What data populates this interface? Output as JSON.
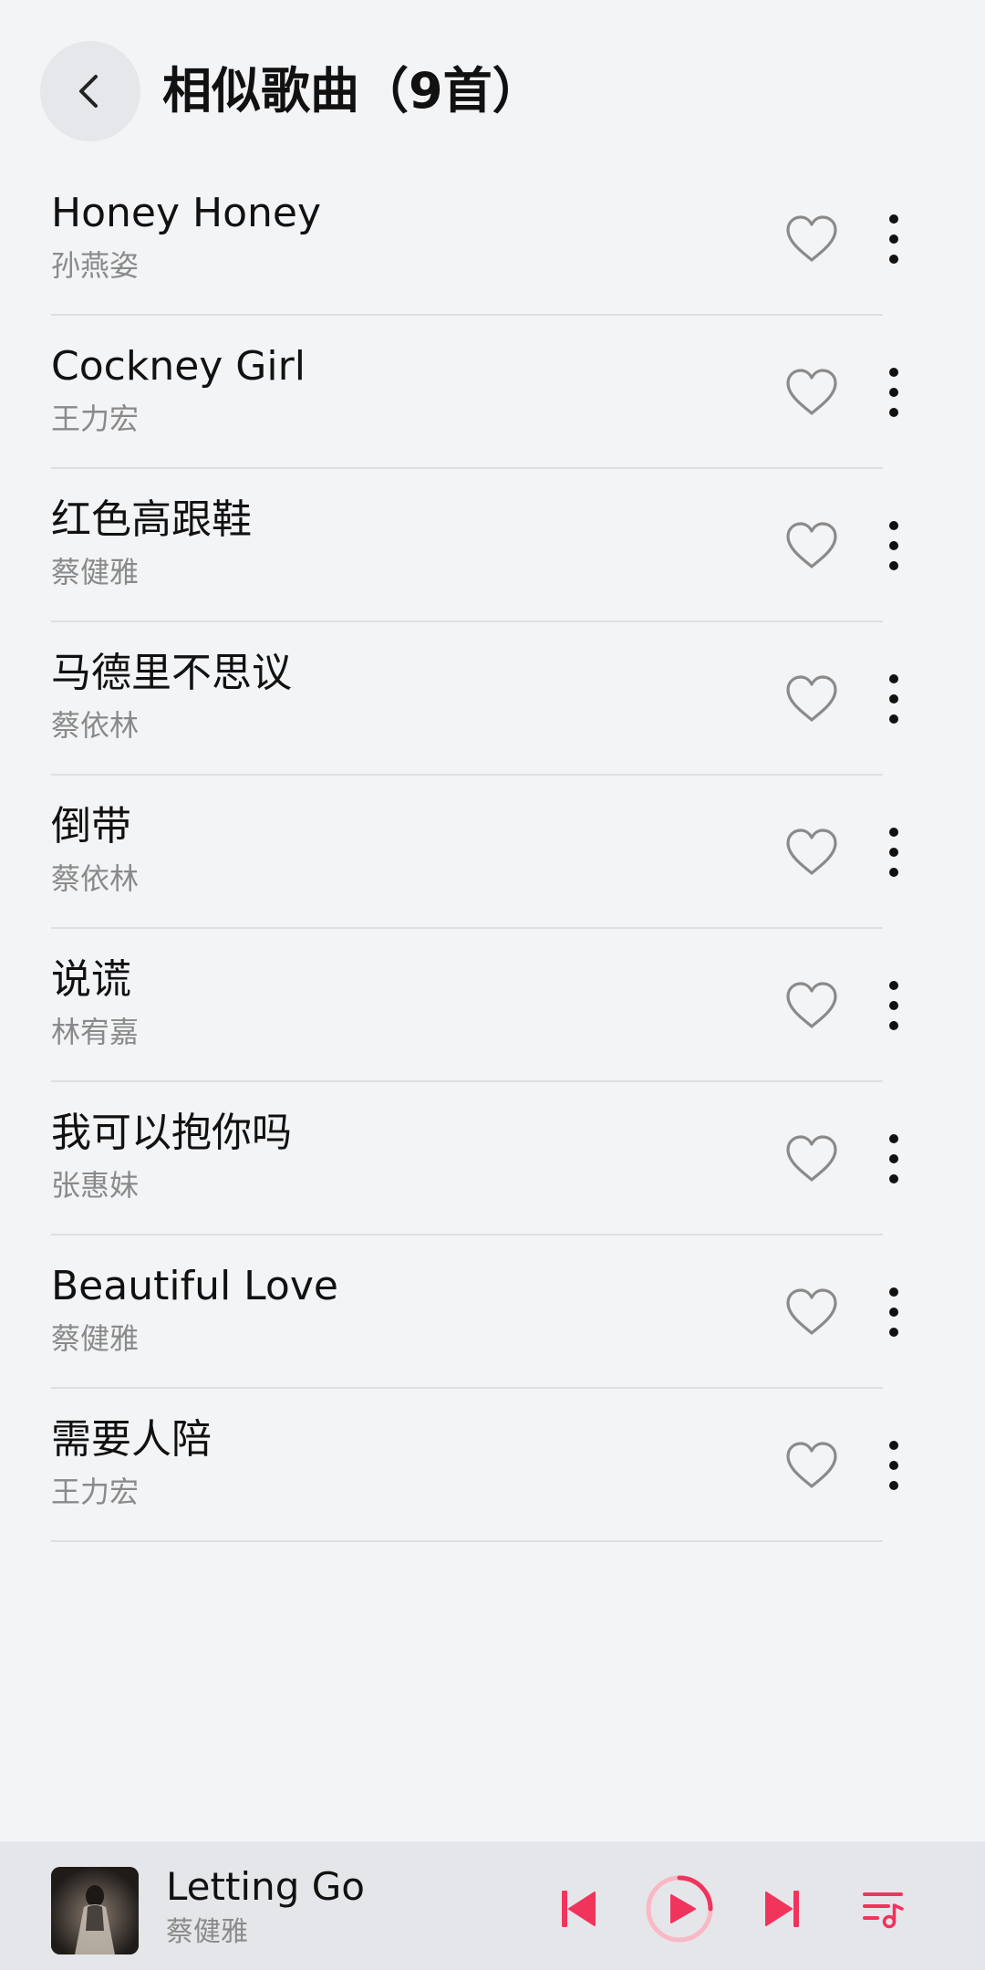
{
  "header": {
    "title": "相似歌曲（9首）"
  },
  "songs": [
    {
      "title": "Honey Honey",
      "artist": "孙燕姿"
    },
    {
      "title": "Cockney Girl",
      "artist": "王力宏"
    },
    {
      "title": "红色高跟鞋",
      "artist": "蔡健雅"
    },
    {
      "title": "马德里不思议",
      "artist": "蔡依林"
    },
    {
      "title": "倒带",
      "artist": "蔡依林"
    },
    {
      "title": "说谎",
      "artist": "林宥嘉"
    },
    {
      "title": "我可以抱你吗",
      "artist": "张惠妹"
    },
    {
      "title": "Beautiful Love",
      "artist": "蔡健雅"
    },
    {
      "title": "需要人陪",
      "artist": "王力宏"
    }
  ],
  "now_playing": {
    "title": "Letting Go",
    "artist": "蔡健雅",
    "progress": 0.25
  },
  "icons": {
    "back": "chevron-left-icon",
    "favorite": "heart-outline-icon",
    "more": "more-vertical-icon",
    "previous": "skip-previous-icon",
    "play": "play-icon",
    "next": "skip-next-icon",
    "queue": "playlist-icon"
  },
  "colors": {
    "background": "#f3f4f6",
    "accent": "#f0345c",
    "accent_light": "#f9b8c6",
    "icon_gray": "#8a8a8a",
    "secondary_text": "#8a8a8a",
    "player_bar": "#e5e6e9"
  }
}
